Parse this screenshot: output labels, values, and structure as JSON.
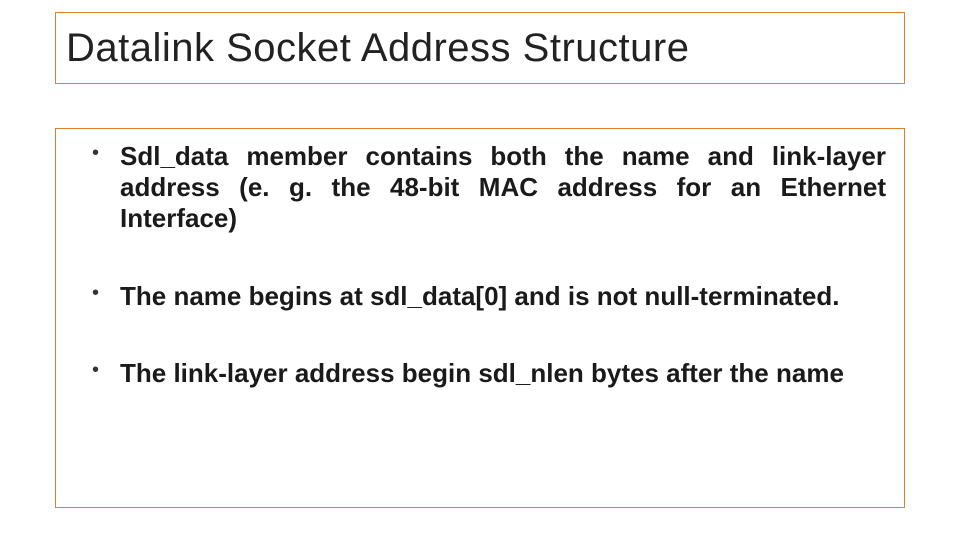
{
  "slide": {
    "title": "Datalink Socket Address Structure",
    "bullets": [
      "Sdl_data member contains both the name and link-layer address (e. g. the 48-bit MAC address for an Ethernet Interface)",
      "The name begins at sdl_data[0] and is not null-terminated.",
      "The link-layer address begin sdl_nlen bytes after the name"
    ]
  }
}
